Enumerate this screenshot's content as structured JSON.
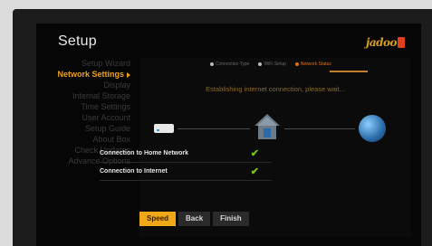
{
  "header": {
    "title": "Setup",
    "logo_text": "jadoo"
  },
  "menu": {
    "items": [
      {
        "label": "Setup Wizard",
        "active": false
      },
      {
        "label": "Network Settings",
        "active": true
      },
      {
        "label": "Display",
        "active": false
      },
      {
        "label": "Internal Storage",
        "active": false
      },
      {
        "label": "Time Settings",
        "active": false
      },
      {
        "label": "User Account",
        "active": false
      },
      {
        "label": "Setup Guide",
        "active": false
      },
      {
        "label": "About Box",
        "active": false
      },
      {
        "label": "Check Updates",
        "active": false
      },
      {
        "label": "Advance Options",
        "active": false
      }
    ]
  },
  "steps": [
    {
      "label": "Connection Type",
      "active": false
    },
    {
      "label": "WiFi Setup",
      "active": false
    },
    {
      "label": "Network Status",
      "active": true
    }
  ],
  "status_text": "Establishing internet connection, please wait...",
  "checks": [
    {
      "label": "Connection to Home Network",
      "state": "ok"
    },
    {
      "label": "Connection to Internet",
      "state": "ok"
    }
  ],
  "check_glyph": "✔",
  "buttons": {
    "speed": "Speed",
    "back": "Back",
    "finish": "Finish"
  },
  "colors": {
    "accent": "#f0a818",
    "ok": "#7ac41a",
    "menu_active": "#f0a020"
  },
  "icons": [
    "router-icon",
    "house-icon",
    "globe-icon",
    "check-icon",
    "arrow-right-icon"
  ]
}
